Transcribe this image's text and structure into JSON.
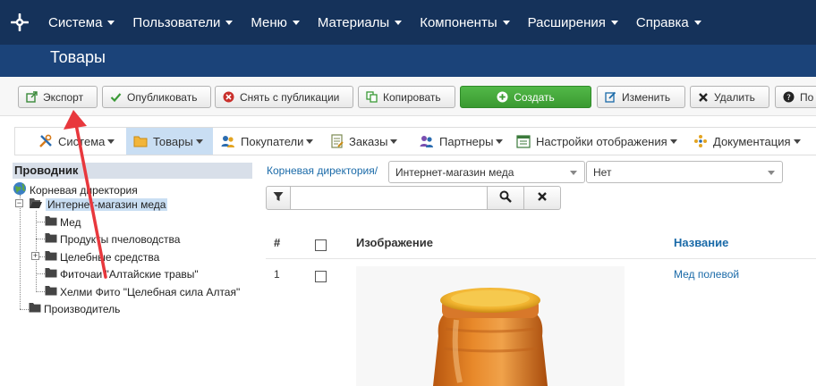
{
  "topnav": {
    "items": [
      {
        "label": "Система"
      },
      {
        "label": "Пользователи"
      },
      {
        "label": "Меню"
      },
      {
        "label": "Материалы"
      },
      {
        "label": "Компоненты"
      },
      {
        "label": "Расширения"
      },
      {
        "label": "Справка"
      }
    ]
  },
  "header": {
    "title": "Товары"
  },
  "toolbar": {
    "export": "Экспорт",
    "publish": "Опубликовать",
    "unpublish": "Снять с публикации",
    "copy": "Копировать",
    "create": "Создать",
    "edit": "Изменить",
    "delete": "Удалить",
    "help": "По"
  },
  "subbar": {
    "items": [
      {
        "label": "Система"
      },
      {
        "label": "Товары"
      },
      {
        "label": "Покупатели"
      },
      {
        "label": "Заказы"
      },
      {
        "label": "Партнеры"
      },
      {
        "label": "Настройки отображения"
      },
      {
        "label": "Документация"
      }
    ]
  },
  "tree": {
    "header": "Проводник",
    "root": "Корневая директория",
    "shop": "Интернет-магазин меда",
    "children": [
      {
        "label": "Мед"
      },
      {
        "label": "Продукты пчеловодства"
      },
      {
        "label": "Целебные средства"
      },
      {
        "label": "Фиточаи \"Алтайские травы\""
      },
      {
        "label": "Хелми Фито \"Целебная сила Алтая\""
      }
    ],
    "manufacturer": "Производитель",
    "plus": "+",
    "minus": "−"
  },
  "filters": {
    "breadcrumb": "Корневая директория/",
    "category": "Интернет-магазин меда",
    "second": "Нет",
    "search_value": ""
  },
  "table": {
    "headers": {
      "num": "#",
      "image": "Изображение",
      "name": "Название"
    },
    "rows": [
      {
        "num": "1",
        "name": "Мед полевой"
      }
    ]
  },
  "colors": {
    "navbar": "#15325a",
    "header": "#1b4379",
    "create_button": "#46a83c",
    "link": "#1a6aa8",
    "annotation_arrow": "#e8383d"
  }
}
